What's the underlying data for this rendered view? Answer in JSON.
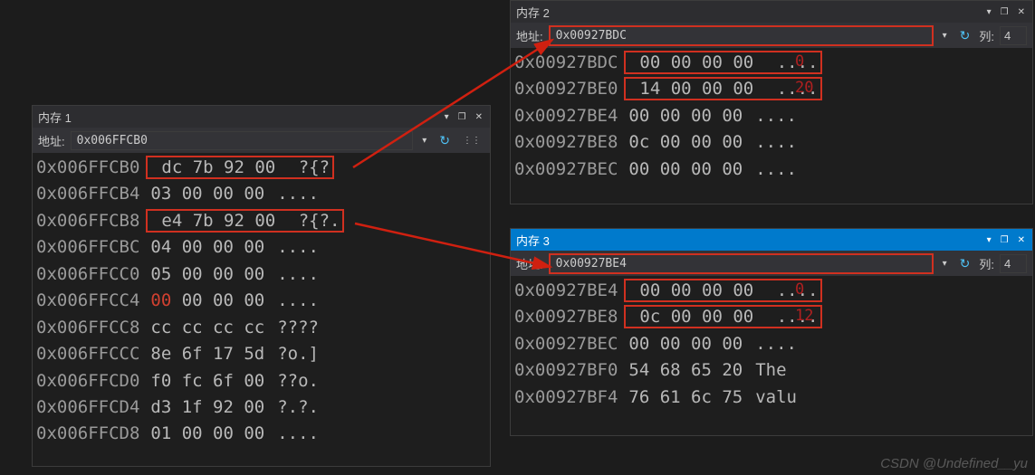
{
  "panel1": {
    "title": "内存 1",
    "addr_label": "地址:",
    "addr_value": "0x006FFCB0",
    "rows": [
      {
        "addr": "0x006FFCB0",
        "bytes": "dc 7b 92 00",
        "ascii": "?{?",
        "hl": true
      },
      {
        "addr": "0x006FFCB4",
        "bytes": "03 00 00 00",
        "ascii": "....",
        "hl": false
      },
      {
        "addr": "0x006FFCB8",
        "bytes": "e4 7b 92 00",
        "ascii": "?{?.",
        "hl": true
      },
      {
        "addr": "0x006FFCBC",
        "bytes": "04 00 00 00",
        "ascii": "....",
        "hl": false
      },
      {
        "addr": "0x006FFCC0",
        "bytes": "05 00 00 00",
        "ascii": "....",
        "hl": false
      },
      {
        "addr": "0x006FFCC4",
        "bytes": "",
        "ascii": "",
        "hl": false,
        "r1": "00",
        "rest": " 00 00 00",
        "asc": "....",
        "red1": true
      },
      {
        "addr": "0x006FFCC8",
        "bytes": "cc cc cc cc",
        "ascii": "????",
        "hl": false
      },
      {
        "addr": "0x006FFCCC",
        "bytes": "8e 6f 17 5d",
        "ascii": "?o.]",
        "hl": false
      },
      {
        "addr": "0x006FFCD0",
        "bytes": "f0 fc 6f 00",
        "ascii": "??o.",
        "hl": false
      },
      {
        "addr": "0x006FFCD4",
        "bytes": "d3 1f 92 00",
        "ascii": "?.?.",
        "hl": false
      },
      {
        "addr": "0x006FFCD8",
        "bytes": "01 00 00 00",
        "ascii": "....",
        "hl": false
      }
    ]
  },
  "panel2": {
    "title": "内存 2",
    "addr_label": "地址:",
    "addr_value": "0x00927BDC",
    "col_label": "列:",
    "col_value": "4",
    "rows": [
      {
        "addr": "0x00927BDC",
        "bytes": "00 00 00 00",
        "ascii": "....",
        "hl": true,
        "note": "0"
      },
      {
        "addr": "0x00927BE0",
        "bytes": "14 00 00 00",
        "ascii": "....",
        "hl": true,
        "note": "20"
      },
      {
        "addr": "0x00927BE4",
        "bytes": "00 00 00 00",
        "ascii": "....",
        "hl": false
      },
      {
        "addr": "0x00927BE8",
        "bytes": "0c 00 00 00",
        "ascii": "....",
        "hl": false
      },
      {
        "addr": "0x00927BEC",
        "bytes": "00 00 00 00",
        "ascii": "....",
        "hl": false
      }
    ]
  },
  "panel3": {
    "title": "内存 3",
    "addr_label": "地址:",
    "addr_value": "0x00927BE4",
    "col_label": "列:",
    "col_value": "4",
    "rows": [
      {
        "addr": "0x00927BE4",
        "bytes": "00 00 00 00",
        "ascii": "....",
        "hl": true,
        "note": "0"
      },
      {
        "addr": "0x00927BE8",
        "bytes": "0c 00 00 00",
        "ascii": "....",
        "hl": true,
        "note": "12"
      },
      {
        "addr": "0x00927BEC",
        "bytes": "00 00 00 00",
        "ascii": "....",
        "hl": false
      },
      {
        "addr": "0x00927BF0",
        "bytes": "54 68 65 20",
        "ascii": "The",
        "hl": false
      },
      {
        "addr": "0x00927BF4",
        "bytes": "76 61 6c 75",
        "ascii": "valu",
        "hl": false
      }
    ]
  },
  "watermark": "CSDN @Undefined__yu"
}
